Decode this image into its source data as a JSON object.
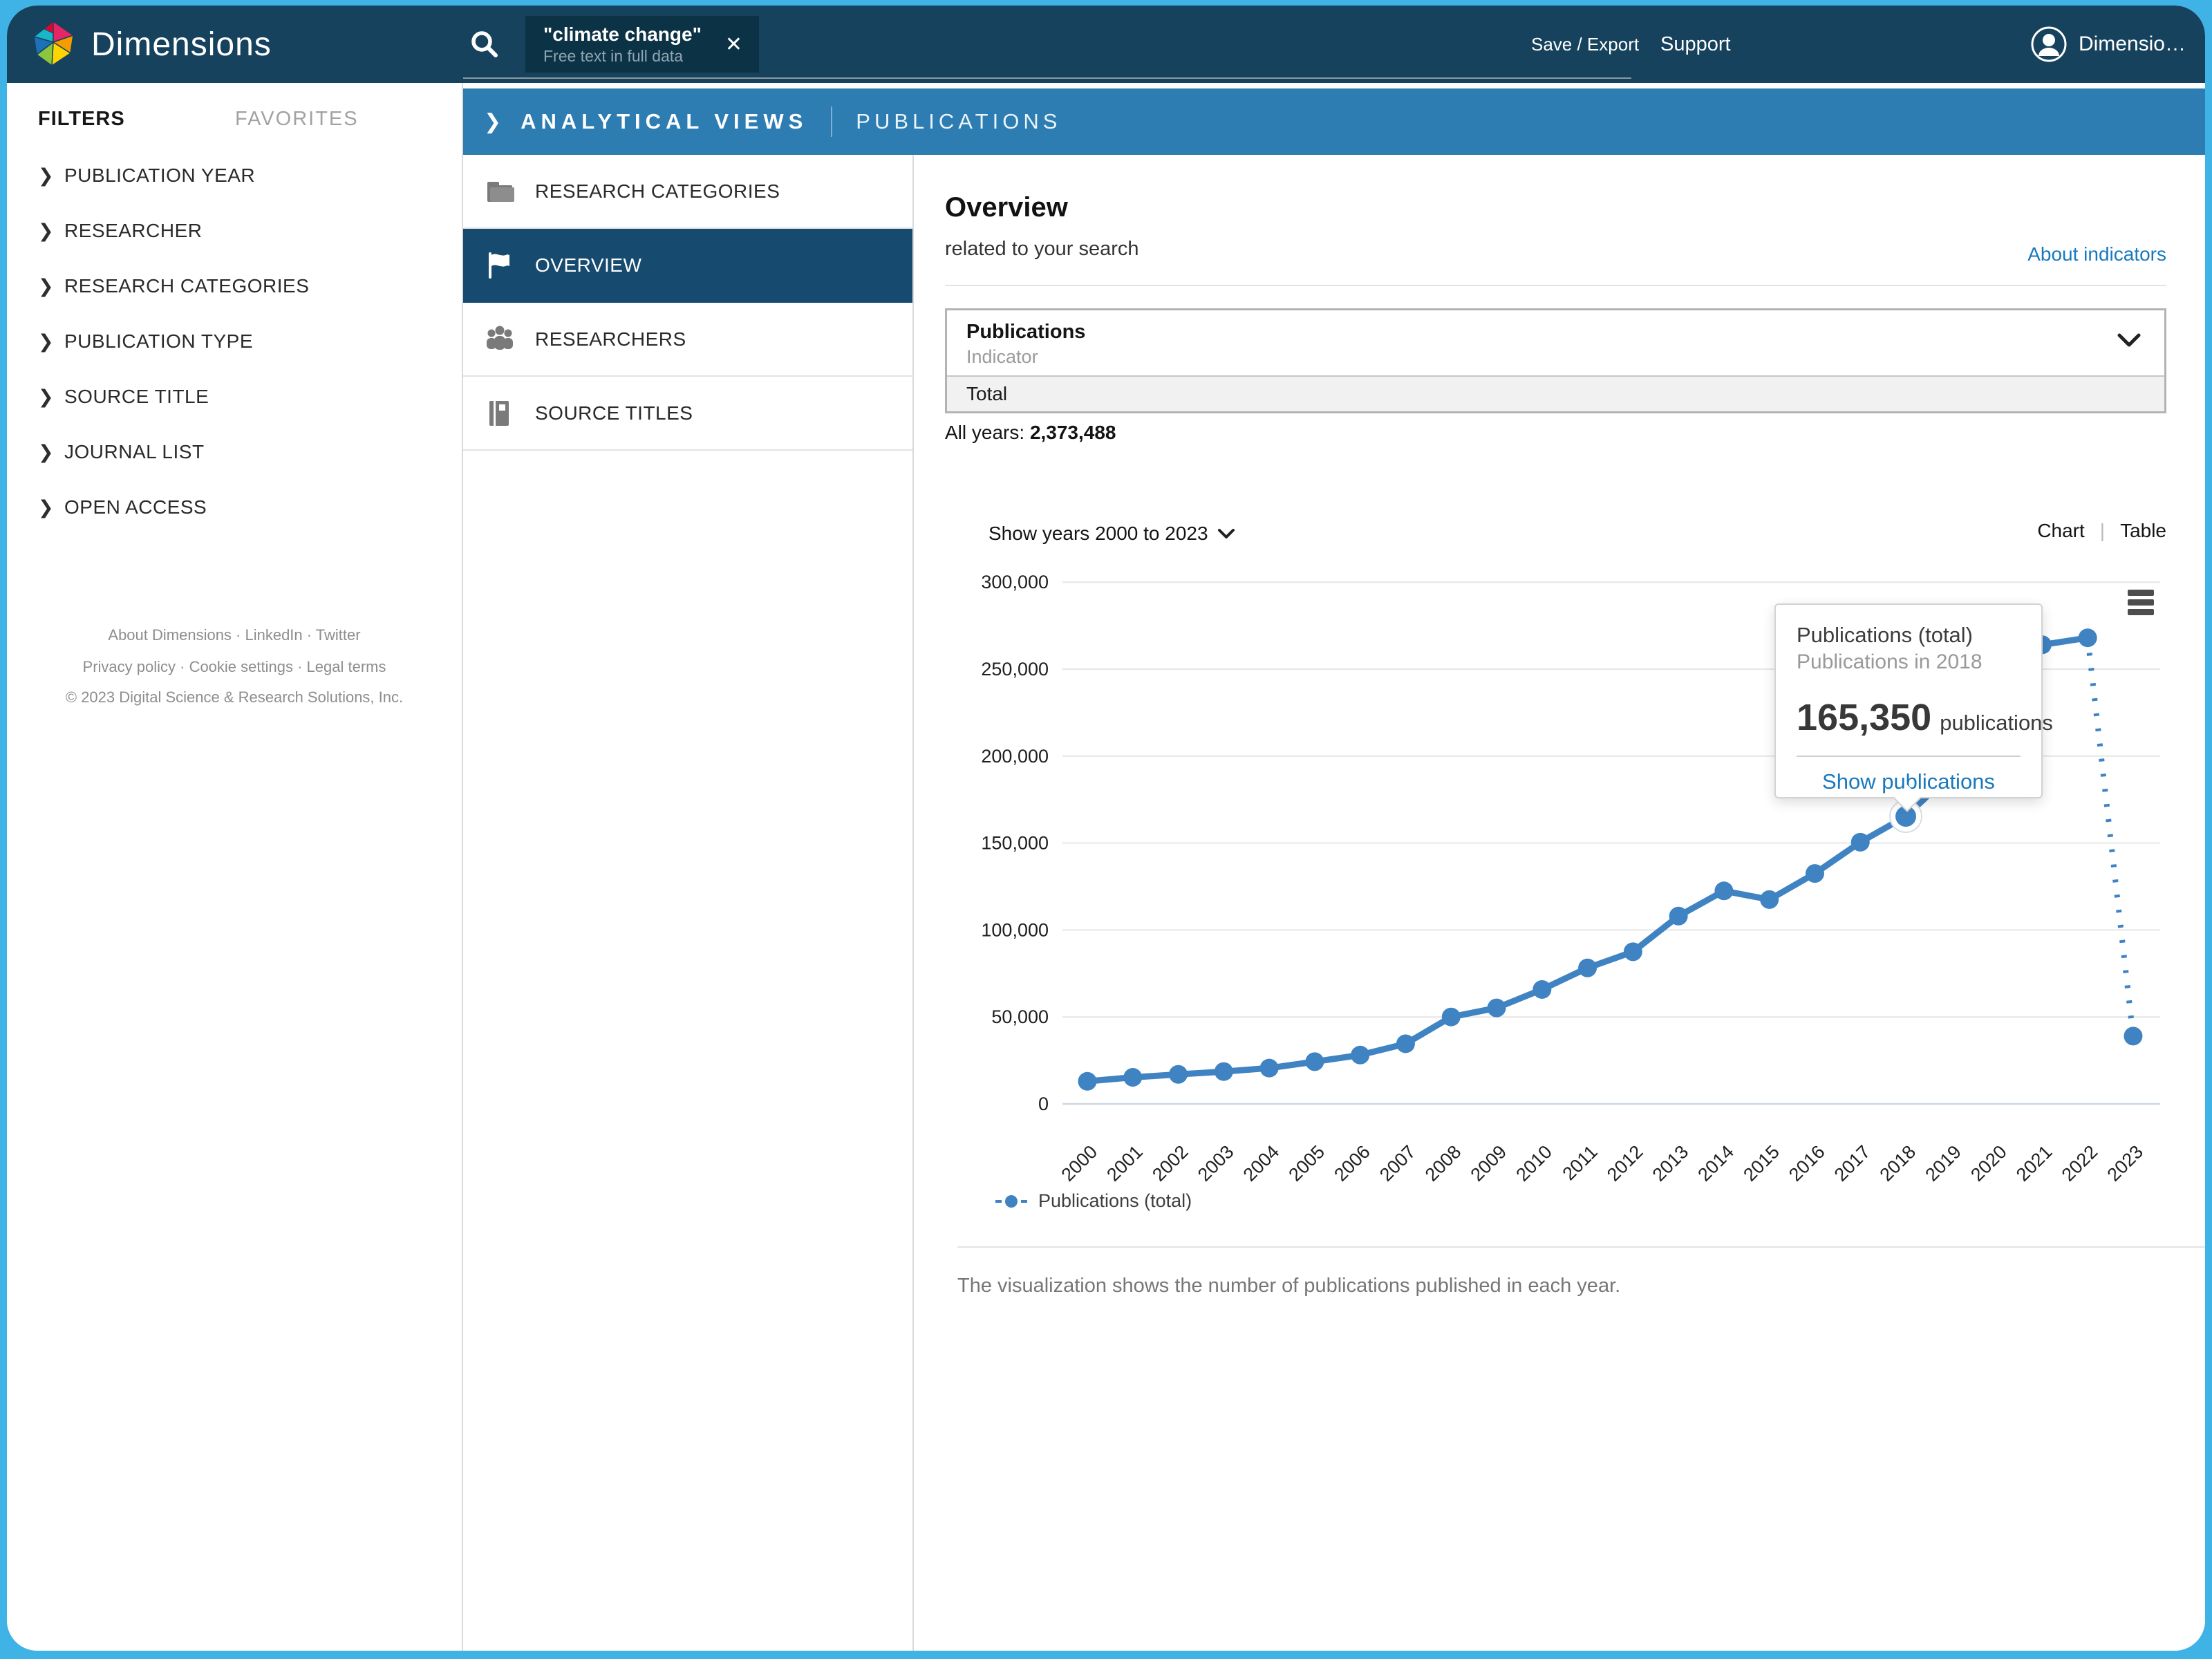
{
  "icons": {
    "chevron_right": "❯",
    "close": "✕"
  },
  "topbar": {
    "brand": "Dimensions",
    "search_chip": {
      "query": "\"climate change\"",
      "scope": "Free text in full data"
    },
    "save_export": "Save / Export",
    "support": "Support",
    "user": "Dimensio…"
  },
  "sidebar": {
    "tabs": [
      {
        "label": "FILTERS"
      },
      {
        "label": "FAVORITES"
      }
    ],
    "filters": [
      "PUBLICATION YEAR",
      "RESEARCHER",
      "RESEARCH CATEGORIES",
      "PUBLICATION TYPE",
      "SOURCE TITLE",
      "JOURNAL LIST",
      "OPEN ACCESS"
    ],
    "footer": [
      "About Dimensions · LinkedIn · Twitter",
      "Privacy policy · Cookie settings · Legal terms",
      "© 2023 Digital Science & Research Solutions, Inc."
    ]
  },
  "breadcrumb": {
    "section": "ANALYTICAL VIEWS",
    "page": "PUBLICATIONS"
  },
  "views_nav": {
    "items": [
      {
        "label": "RESEARCH CATEGORIES",
        "icon": "folder-icon",
        "selected": false
      },
      {
        "label": "OVERVIEW",
        "icon": "flag-icon",
        "selected": true
      },
      {
        "label": "RESEARCHERS",
        "icon": "people-icon",
        "selected": false
      },
      {
        "label": "SOURCE TITLES",
        "icon": "book-icon",
        "selected": false
      }
    ]
  },
  "main": {
    "title": "Overview",
    "subtitle": "related to your search",
    "about_link": "About indicators",
    "indicator": {
      "name": "Publications",
      "type_label": "Indicator",
      "selected_option": "Total"
    },
    "all_years_label": "All years: ",
    "all_years_value": "2,373,488",
    "show_years": "Show years 2000 to 2023",
    "view_toggle": {
      "chart": "Chart",
      "table": "Table"
    },
    "legend": "Publications (total)",
    "caption": "The visualization shows the number of publications published in each year."
  },
  "tooltip": {
    "title": "Publications (total)",
    "subtitle": "Publications in 2018",
    "value": "165,350",
    "unit": "publications",
    "action": "Show publications"
  },
  "chart_data": {
    "type": "line",
    "title": "",
    "xlabel": "",
    "ylabel": "",
    "x": [
      2000,
      2001,
      2002,
      2003,
      2004,
      2005,
      2006,
      2007,
      2008,
      2009,
      2010,
      2011,
      2012,
      2013,
      2014,
      2015,
      2016,
      2017,
      2018,
      2019,
      2020,
      2021,
      2022,
      2023
    ],
    "series": [
      {
        "name": "Publications (total)",
        "values": [
          13000,
          15300,
          17000,
          18600,
          20600,
          24300,
          28100,
          34600,
          50000,
          55200,
          65800,
          78200,
          87500,
          108000,
          122500,
          117500,
          132500,
          150500,
          165350,
          190000,
          250000,
          264000,
          268000,
          39000
        ]
      }
    ],
    "ylim": [
      0,
      300000
    ],
    "ytick_interval": 50000,
    "grid": true,
    "legend_position": "bottom-left",
    "highlight": {
      "year": 2018,
      "value": 165350
    },
    "dotted_segment_from_year": 2022,
    "hidden_behind_tooltip_years": [
      2019,
      2020
    ],
    "series_color": "#3f83c2"
  }
}
